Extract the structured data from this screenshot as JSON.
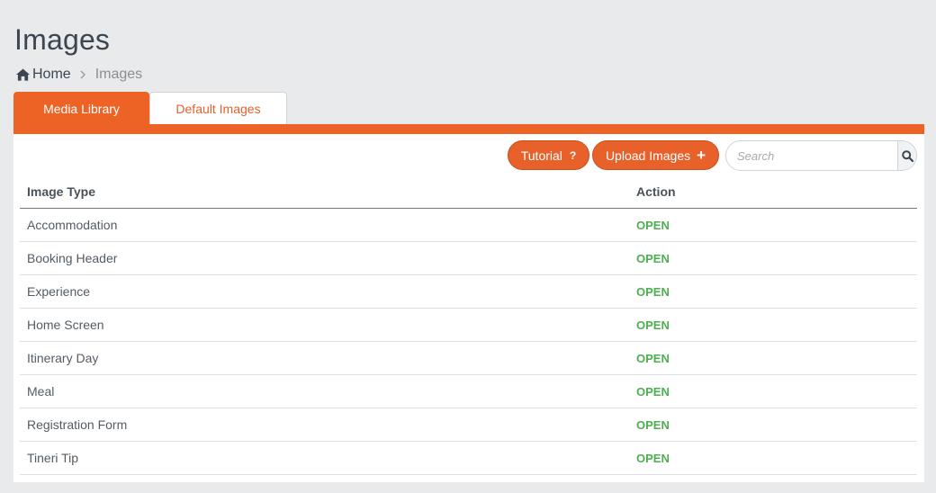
{
  "page": {
    "title": "Images"
  },
  "breadcrumb": {
    "home": "Home",
    "separator": ">",
    "current": "Images"
  },
  "tabs": [
    {
      "label": "Media Library",
      "active": true
    },
    {
      "label": "Default Images",
      "active": false
    }
  ],
  "toolbar": {
    "tutorial_label": "Tutorial",
    "tutorial_icon": "?",
    "upload_label": "Upload Images",
    "upload_icon": "+",
    "search_placeholder": "Search"
  },
  "table": {
    "headers": [
      "Image Type",
      "Action"
    ],
    "rows": [
      {
        "type": "Accommodation",
        "action": "OPEN"
      },
      {
        "type": "Booking Header",
        "action": "OPEN"
      },
      {
        "type": "Experience",
        "action": "OPEN"
      },
      {
        "type": "Home Screen",
        "action": "OPEN"
      },
      {
        "type": "Itinerary Day",
        "action": "OPEN"
      },
      {
        "type": "Meal",
        "action": "OPEN"
      },
      {
        "type": "Registration Form",
        "action": "OPEN"
      },
      {
        "type": "Tineri Tip",
        "action": "OPEN"
      }
    ]
  },
  "colors": {
    "accent": "#ed6325",
    "open": "#4caf50",
    "background": "#e8eaeb"
  }
}
